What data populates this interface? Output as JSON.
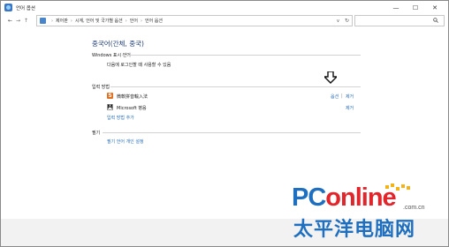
{
  "window": {
    "title": "언어 옵션",
    "controls": {
      "minimize": "—",
      "maximize": "☐",
      "close": "✕"
    }
  },
  "navbar": {
    "back": "←",
    "forward": "→",
    "up": "↑",
    "breadcrumb": [
      "제어판",
      "시계, 언어 및 국가별 옵션",
      "언어",
      "언어 옵션"
    ],
    "breadcrumb_sep": "›",
    "dropdown": "v",
    "refresh": "↻",
    "search_icon": "search-icon"
  },
  "main": {
    "heading": "중국어(간체, 중국)",
    "display_language": {
      "label": "Windows 표시 언어",
      "status": "다음에 로그인할 때 사용할 수 있음"
    },
    "input_methods": {
      "label": "입력 방법",
      "items": [
        {
          "name": "微軟拼音輸入法",
          "icon": "ime-icon",
          "glyph": "S",
          "options_link": "옵션",
          "separator": "|",
          "remove_link": "제거"
        },
        {
          "name": "Microsoft 병음",
          "icon": "microsoft-icon",
          "glyph": "M",
          "remove_link": "제거"
        }
      ],
      "add_link": "입력 방법 추가"
    },
    "handwriting": {
      "label": "필기",
      "link": "필기 언어 개인 설정"
    }
  },
  "watermark": {
    "brand_pc": "PC",
    "brand_online": "online",
    "domain": ".com.cn",
    "chinese": "太平洋电脑网",
    "colors": {
      "blue": "#1f6fc0",
      "red": "#e2242b",
      "orange": "#f2b31a"
    }
  },
  "colors": {
    "heading": "#1e3c78",
    "link": "#2a6fb8",
    "ime_icon": "#e07020"
  }
}
